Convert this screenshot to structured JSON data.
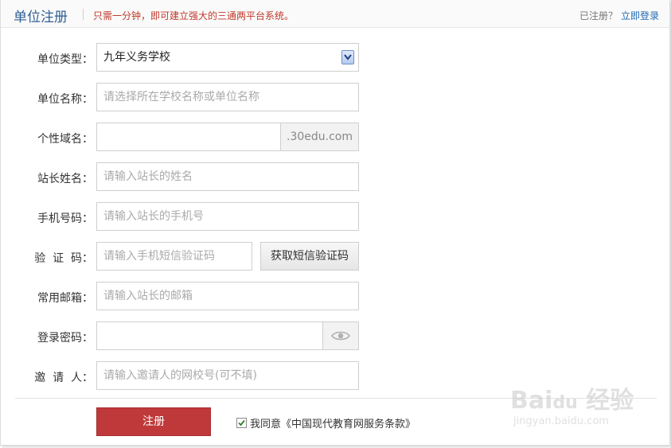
{
  "header": {
    "title": "单位注册",
    "subtitle": "只需一分钟，即可建立强大的三通两平台系统。",
    "already_registered": "已注册？",
    "login_link": "立即登录"
  },
  "form": {
    "org_type": {
      "label": "单位类型：",
      "value": "九年义务学校"
    },
    "org_name": {
      "label": "单位名称：",
      "placeholder": "请选择所在学校名称或单位名称"
    },
    "domain": {
      "label": "个性域名：",
      "value": "",
      "suffix": ".30edu.com"
    },
    "admin_name": {
      "label": "站长姓名：",
      "placeholder": "请输入站长的姓名"
    },
    "phone": {
      "label": "手机号码：",
      "placeholder": "请输入站长的手机号"
    },
    "code": {
      "label": "验  证  码：",
      "placeholder": "请输入手机短信验证码",
      "button": "获取短信验证码"
    },
    "email": {
      "label": "常用邮箱：",
      "placeholder": "请输入站长的邮箱"
    },
    "password": {
      "label": "登录密码：",
      "value": ""
    },
    "inviter": {
      "label": "邀  请  人：",
      "placeholder": "请输入邀请人的网校号(可不填)"
    }
  },
  "submit_label": "注册",
  "agreement": {
    "checked": true,
    "text": "我同意《中国现代教育网服务条款》"
  },
  "watermark": {
    "brand": "Bai du 经验",
    "url": "jingyan.baidu.com"
  }
}
